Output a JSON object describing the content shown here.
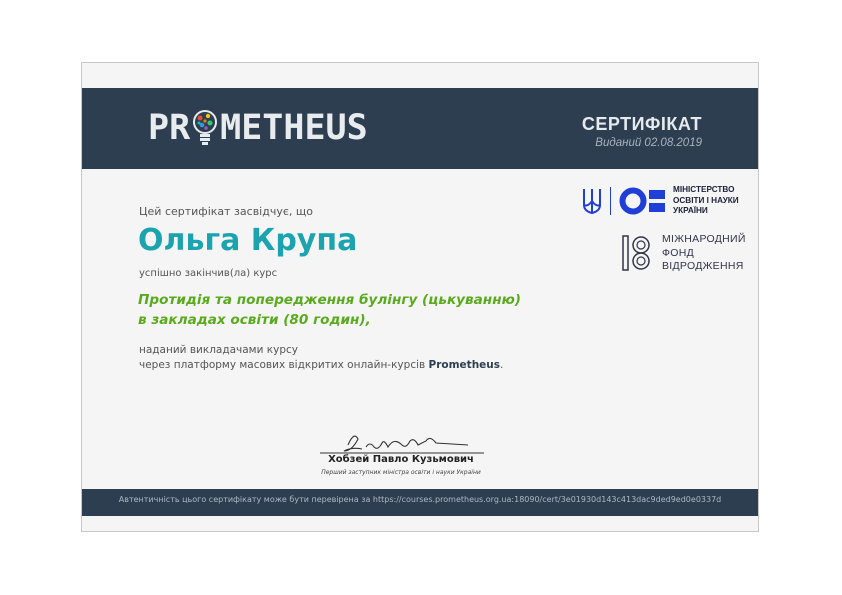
{
  "brand": {
    "logo_left": "PR",
    "logo_right": "METHEUS"
  },
  "header": {
    "title": "СЕРТИФІКАТ",
    "issued": "Виданий 02.08.2019"
  },
  "body": {
    "intro": "Цей сертифікат засвідчує, що",
    "name": "Ольга Крупа",
    "completed": "успішно закінчив(ла) курс",
    "course_line1": "Протидія та попередження булінгу (цькуванню)",
    "course_line2": "в закладах освіти (80 годин),",
    "provider_line1": "наданий викладачами курсу",
    "provider_line2_prefix": "через платформу масових відкритих онлайн-курсів ",
    "provider_brand": "Prometheus",
    "provider_suffix": "."
  },
  "partners": {
    "ministry": [
      "МІНІСТЕРСТВО",
      "ОСВІТИ І НАУКИ",
      "УКРАЇНИ"
    ],
    "fund": [
      "МІЖНАРОДНИЙ",
      "ФОНД",
      "ВІДРОДЖЕННЯ"
    ]
  },
  "signature": {
    "name": "Хобзей Павло Кузьмович",
    "title": "Перший заступник міністра освіти і науки України"
  },
  "footer": {
    "text": "Автентичність цього сертифікату може бути перевірена за https://courses.prometheus.org.ua:18090/cert/3e01930d143c413dac9ded9ed0e0337d"
  },
  "colors": {
    "header_bg": "#2e3e51",
    "name": "#1ba3b0",
    "course": "#5aaa1e",
    "ministry_blue": "#1f3fd6"
  }
}
